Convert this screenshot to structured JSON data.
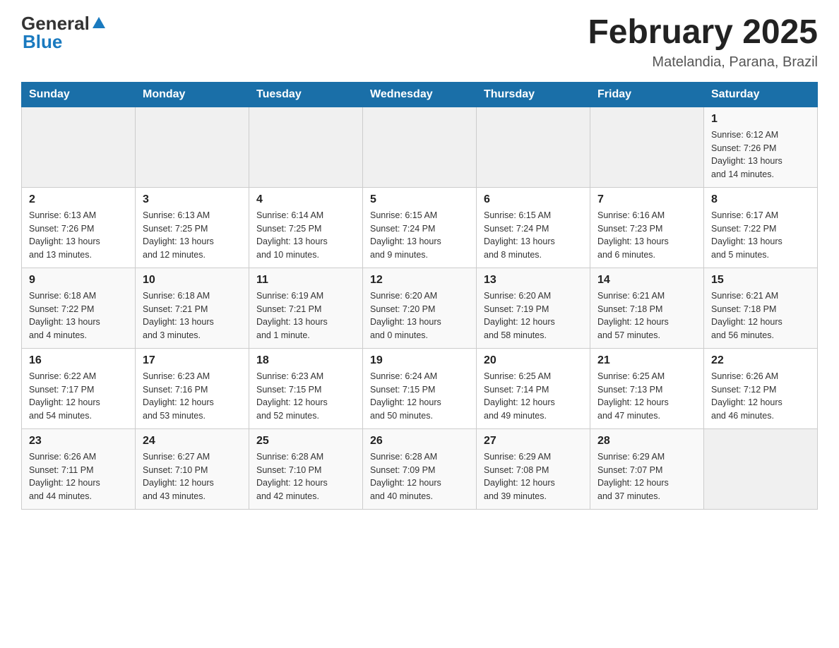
{
  "header": {
    "logo_general": "General",
    "logo_blue": "Blue",
    "month_title": "February 2025",
    "location": "Matelandia, Parana, Brazil"
  },
  "days_of_week": [
    "Sunday",
    "Monday",
    "Tuesday",
    "Wednesday",
    "Thursday",
    "Friday",
    "Saturday"
  ],
  "weeks": [
    [
      {
        "day": "",
        "info": ""
      },
      {
        "day": "",
        "info": ""
      },
      {
        "day": "",
        "info": ""
      },
      {
        "day": "",
        "info": ""
      },
      {
        "day": "",
        "info": ""
      },
      {
        "day": "",
        "info": ""
      },
      {
        "day": "1",
        "info": "Sunrise: 6:12 AM\nSunset: 7:26 PM\nDaylight: 13 hours\nand 14 minutes."
      }
    ],
    [
      {
        "day": "2",
        "info": "Sunrise: 6:13 AM\nSunset: 7:26 PM\nDaylight: 13 hours\nand 13 minutes."
      },
      {
        "day": "3",
        "info": "Sunrise: 6:13 AM\nSunset: 7:25 PM\nDaylight: 13 hours\nand 12 minutes."
      },
      {
        "day": "4",
        "info": "Sunrise: 6:14 AM\nSunset: 7:25 PM\nDaylight: 13 hours\nand 10 minutes."
      },
      {
        "day": "5",
        "info": "Sunrise: 6:15 AM\nSunset: 7:24 PM\nDaylight: 13 hours\nand 9 minutes."
      },
      {
        "day": "6",
        "info": "Sunrise: 6:15 AM\nSunset: 7:24 PM\nDaylight: 13 hours\nand 8 minutes."
      },
      {
        "day": "7",
        "info": "Sunrise: 6:16 AM\nSunset: 7:23 PM\nDaylight: 13 hours\nand 6 minutes."
      },
      {
        "day": "8",
        "info": "Sunrise: 6:17 AM\nSunset: 7:22 PM\nDaylight: 13 hours\nand 5 minutes."
      }
    ],
    [
      {
        "day": "9",
        "info": "Sunrise: 6:18 AM\nSunset: 7:22 PM\nDaylight: 13 hours\nand 4 minutes."
      },
      {
        "day": "10",
        "info": "Sunrise: 6:18 AM\nSunset: 7:21 PM\nDaylight: 13 hours\nand 3 minutes."
      },
      {
        "day": "11",
        "info": "Sunrise: 6:19 AM\nSunset: 7:21 PM\nDaylight: 13 hours\nand 1 minute."
      },
      {
        "day": "12",
        "info": "Sunrise: 6:20 AM\nSunset: 7:20 PM\nDaylight: 13 hours\nand 0 minutes."
      },
      {
        "day": "13",
        "info": "Sunrise: 6:20 AM\nSunset: 7:19 PM\nDaylight: 12 hours\nand 58 minutes."
      },
      {
        "day": "14",
        "info": "Sunrise: 6:21 AM\nSunset: 7:18 PM\nDaylight: 12 hours\nand 57 minutes."
      },
      {
        "day": "15",
        "info": "Sunrise: 6:21 AM\nSunset: 7:18 PM\nDaylight: 12 hours\nand 56 minutes."
      }
    ],
    [
      {
        "day": "16",
        "info": "Sunrise: 6:22 AM\nSunset: 7:17 PM\nDaylight: 12 hours\nand 54 minutes."
      },
      {
        "day": "17",
        "info": "Sunrise: 6:23 AM\nSunset: 7:16 PM\nDaylight: 12 hours\nand 53 minutes."
      },
      {
        "day": "18",
        "info": "Sunrise: 6:23 AM\nSunset: 7:15 PM\nDaylight: 12 hours\nand 52 minutes."
      },
      {
        "day": "19",
        "info": "Sunrise: 6:24 AM\nSunset: 7:15 PM\nDaylight: 12 hours\nand 50 minutes."
      },
      {
        "day": "20",
        "info": "Sunrise: 6:25 AM\nSunset: 7:14 PM\nDaylight: 12 hours\nand 49 minutes."
      },
      {
        "day": "21",
        "info": "Sunrise: 6:25 AM\nSunset: 7:13 PM\nDaylight: 12 hours\nand 47 minutes."
      },
      {
        "day": "22",
        "info": "Sunrise: 6:26 AM\nSunset: 7:12 PM\nDaylight: 12 hours\nand 46 minutes."
      }
    ],
    [
      {
        "day": "23",
        "info": "Sunrise: 6:26 AM\nSunset: 7:11 PM\nDaylight: 12 hours\nand 44 minutes."
      },
      {
        "day": "24",
        "info": "Sunrise: 6:27 AM\nSunset: 7:10 PM\nDaylight: 12 hours\nand 43 minutes."
      },
      {
        "day": "25",
        "info": "Sunrise: 6:28 AM\nSunset: 7:10 PM\nDaylight: 12 hours\nand 42 minutes."
      },
      {
        "day": "26",
        "info": "Sunrise: 6:28 AM\nSunset: 7:09 PM\nDaylight: 12 hours\nand 40 minutes."
      },
      {
        "day": "27",
        "info": "Sunrise: 6:29 AM\nSunset: 7:08 PM\nDaylight: 12 hours\nand 39 minutes."
      },
      {
        "day": "28",
        "info": "Sunrise: 6:29 AM\nSunset: 7:07 PM\nDaylight: 12 hours\nand 37 minutes."
      },
      {
        "day": "",
        "info": ""
      }
    ]
  ]
}
